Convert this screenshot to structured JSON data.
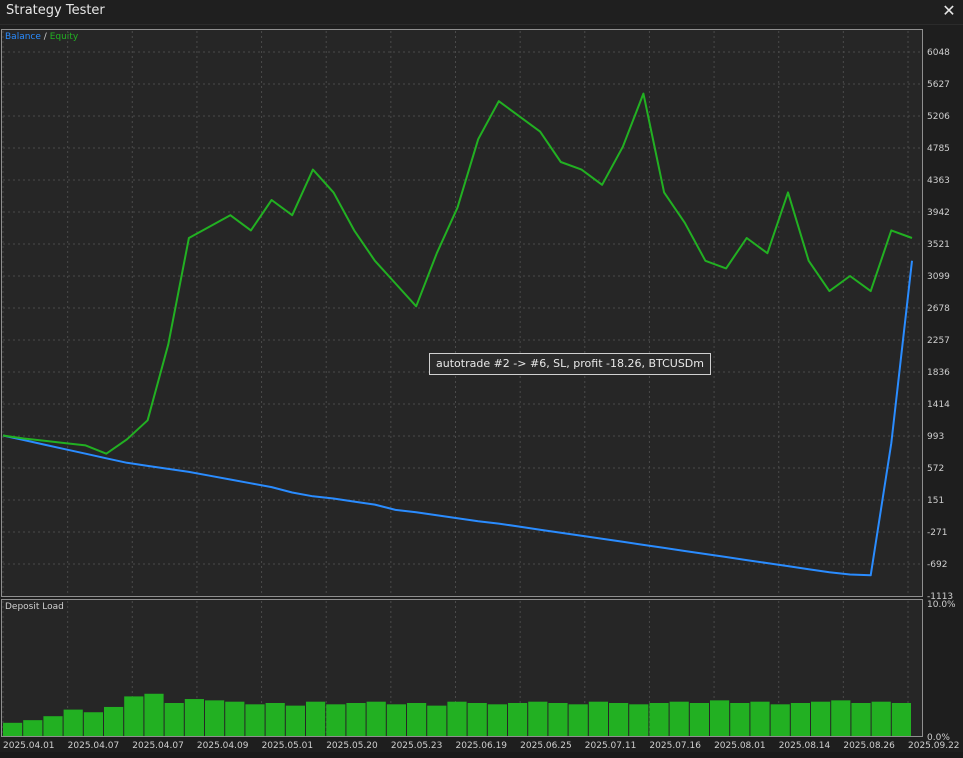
{
  "window": {
    "title": "Strategy Tester",
    "close_icon": "close-icon"
  },
  "legend": {
    "balance_label": "Balance",
    "separator": "/",
    "equity_label": "Equity",
    "balance_color": "#2a8cff",
    "equity_color": "#22b022"
  },
  "deposit_load": {
    "title": "Deposit Load",
    "top_label": "10.0%",
    "bottom_label": "0.0%",
    "bar_color": "#22b022"
  },
  "tooltip": {
    "text": "autotrade #2 -> #6, SL, profit -18.26, BTCUSDm"
  },
  "chart_data": {
    "type": "line",
    "y_ticks": [
      "6048",
      "5627",
      "5206",
      "4785",
      "4363",
      "3942",
      "3521",
      "3099",
      "2678",
      "2257",
      "1836",
      "1414",
      "993",
      "572",
      "151",
      "-271",
      "-692",
      "-1113"
    ],
    "x_ticks": [
      "2025.04.01",
      "2025.04.07",
      "2025.04.07",
      "2025.04.09",
      "2025.05.01",
      "2025.05.20",
      "2025.05.23",
      "2025.06.19",
      "2025.06.25",
      "2025.07.11",
      "2025.07.16",
      "2025.08.01",
      "2025.08.14",
      "2025.08.26",
      "2025.09.22"
    ],
    "ylim": [
      -1113,
      6048
    ],
    "grid": true,
    "legend_position": "top-left",
    "series": [
      {
        "name": "Balance",
        "color": "#2a8cff",
        "values": [
          1000,
          940,
          880,
          820,
          760,
          700,
          640,
          600,
          560,
          520,
          470,
          420,
          370,
          320,
          250,
          200,
          170,
          130,
          90,
          20,
          -10,
          -50,
          -90,
          -130,
          -160,
          -200,
          -240,
          -280,
          -320,
          -360,
          -400,
          -440,
          -480,
          -520,
          -560,
          -600,
          -640,
          -680,
          -720,
          -760,
          -800,
          -830,
          -840,
          900,
          3300
        ]
      },
      {
        "name": "Equity",
        "color": "#22b022",
        "values": [
          1000,
          960,
          930,
          900,
          870,
          760,
          950,
          1200,
          2200,
          3600,
          3750,
          3900,
          3700,
          4100,
          3900,
          4500,
          4200,
          3700,
          3300,
          3000,
          2700,
          3400,
          4000,
          4900,
          5400,
          5200,
          5000,
          4600,
          4500,
          4300,
          4800,
          5500,
          4200,
          3800,
          3300,
          3200,
          3600,
          3400,
          4200,
          3300,
          2900,
          3100,
          2900,
          3700,
          3600
        ]
      }
    ]
  },
  "load_chart": {
    "values": [
      1.0,
      1.2,
      1.5,
      2.0,
      1.8,
      2.2,
      3.0,
      3.2,
      2.5,
      2.8,
      2.7,
      2.6,
      2.4,
      2.5,
      2.3,
      2.6,
      2.4,
      2.5,
      2.6,
      2.4,
      2.5,
      2.3,
      2.6,
      2.5,
      2.4,
      2.5,
      2.6,
      2.5,
      2.4,
      2.6,
      2.5,
      2.4,
      2.5,
      2.6,
      2.5,
      2.7,
      2.5,
      2.6,
      2.4,
      2.5,
      2.6,
      2.7,
      2.5,
      2.6,
      2.5
    ]
  }
}
